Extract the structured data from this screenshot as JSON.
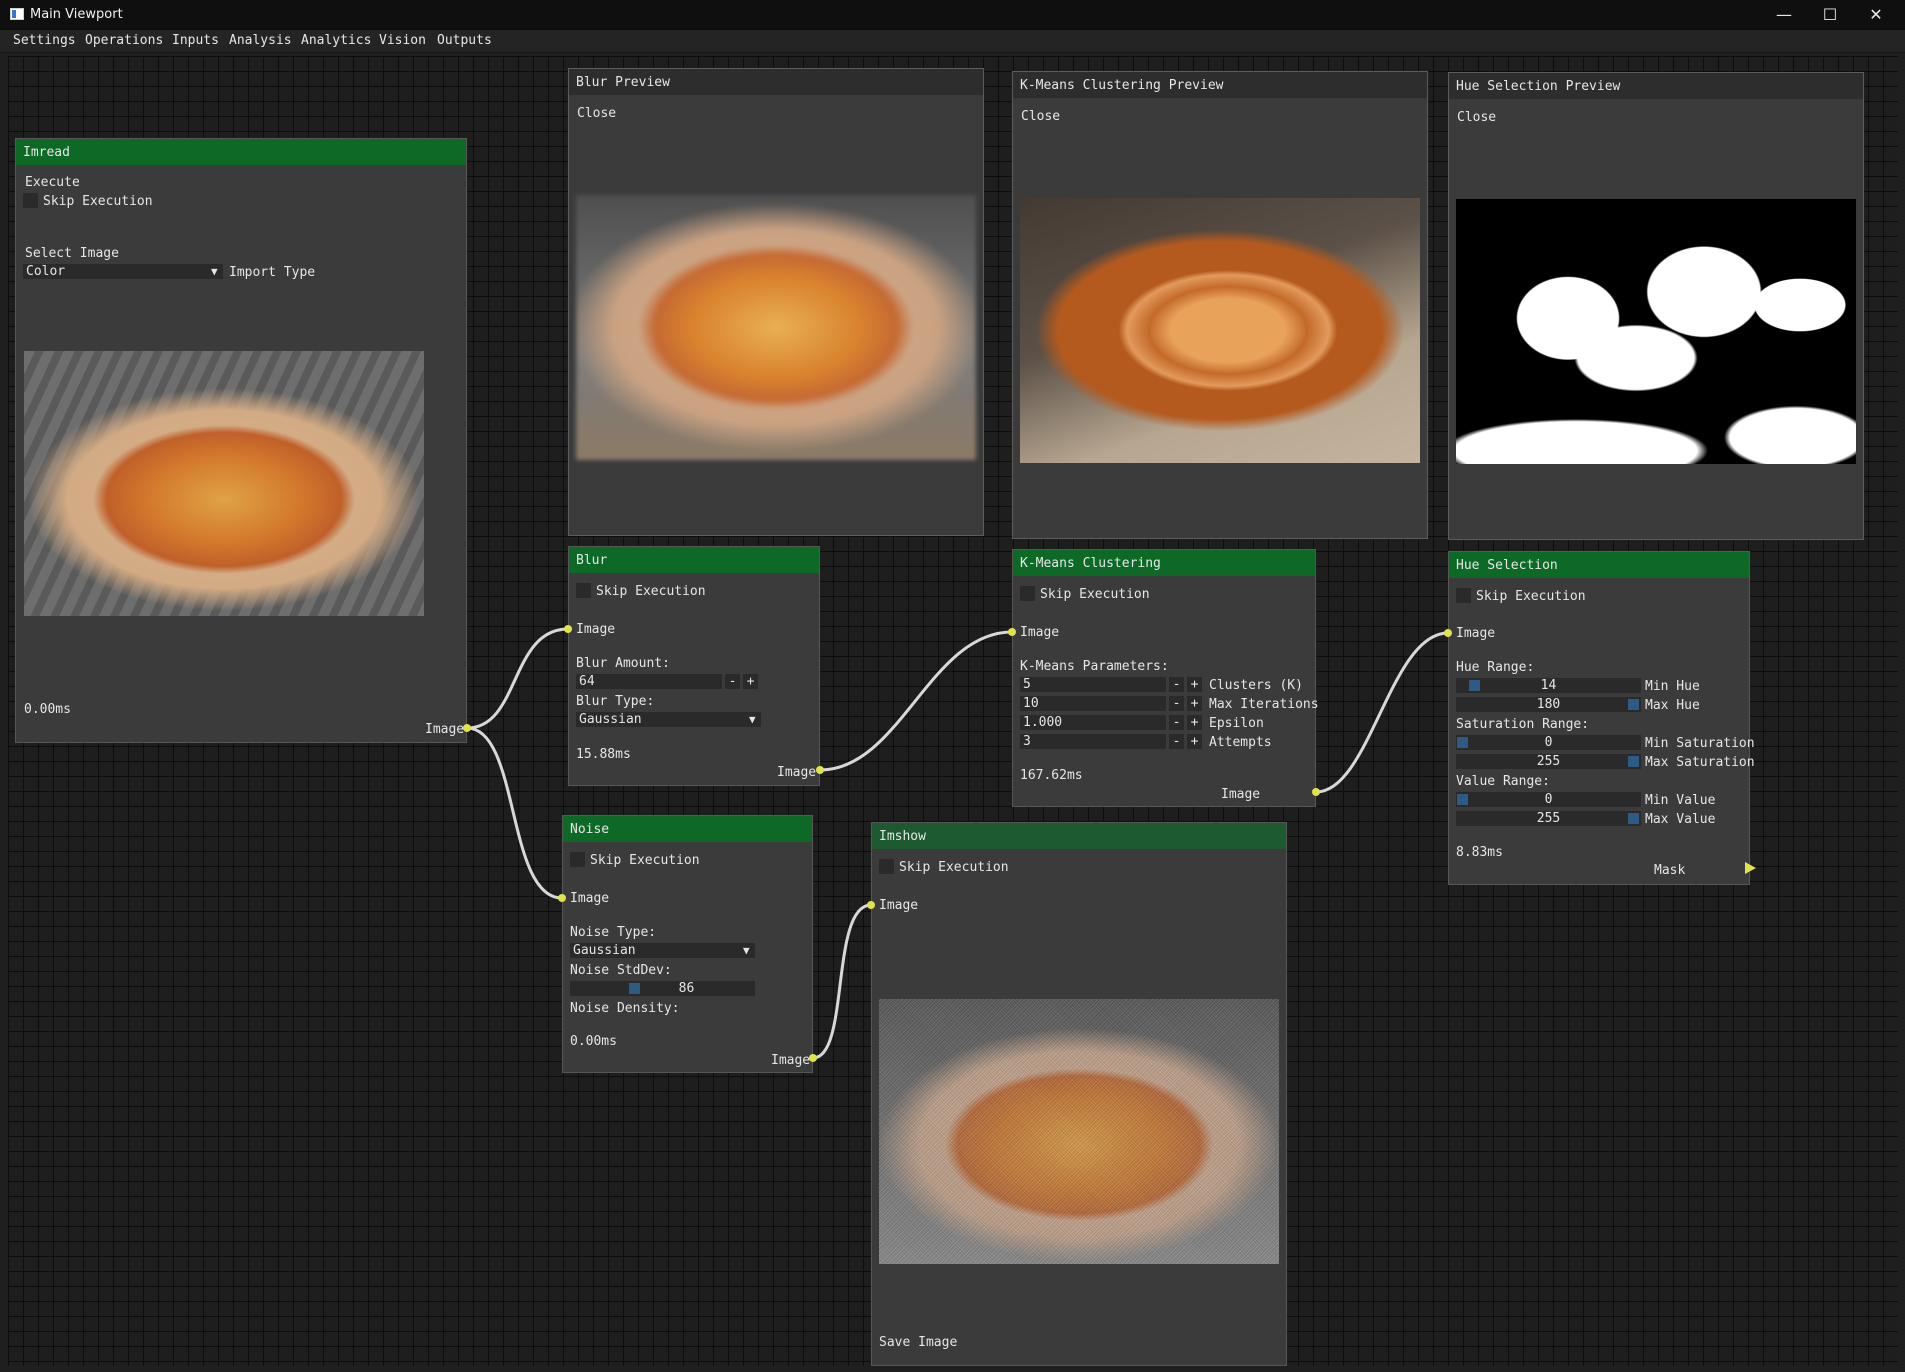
{
  "window": {
    "title": "Main Viewport",
    "minimize": "—",
    "maximize": "☐",
    "close": "✕"
  },
  "menu": [
    "Settings",
    "Operations",
    "Inputs",
    "Analysis",
    "Analytics",
    "Vision",
    "Outputs"
  ],
  "imread": {
    "title": "Imread",
    "execute": "Execute",
    "skip": "Skip Execution",
    "select_image": "Select Image",
    "import_value": "Color",
    "import_label": "Import Type",
    "time": "0.00ms",
    "out": "Image"
  },
  "blur_preview": {
    "title": "Blur Preview",
    "close": "Close"
  },
  "kmeans_preview": {
    "title": "K-Means Clustering Preview",
    "close": "Close"
  },
  "hue_preview": {
    "title": "Hue Selection Preview",
    "close": "Close"
  },
  "blur": {
    "title": "Blur",
    "skip": "Skip Execution",
    "in": "Image",
    "amount_label": "Blur Amount:",
    "amount": "64",
    "minus": "-",
    "plus": "+",
    "type_label": "Blur Type:",
    "type": "Gaussian",
    "time": "15.88ms",
    "out": "Image"
  },
  "kmeans": {
    "title": "K-Means Clustering",
    "skip": "Skip Execution",
    "in": "Image",
    "params_label": "K-Means Parameters:",
    "params": [
      {
        "value": "5",
        "label": "Clusters (K)"
      },
      {
        "value": "10",
        "label": "Max Iterations"
      },
      {
        "value": "1.000",
        "label": "Epsilon"
      },
      {
        "value": "3",
        "label": "Attempts"
      }
    ],
    "minus": "-",
    "plus": "+",
    "time": "167.62ms",
    "out": "Image"
  },
  "hue": {
    "title": "Hue Selection",
    "skip": "Skip Execution",
    "in": "Image",
    "hue_label": "Hue Range:",
    "min_hue": "14",
    "min_hue_label": "Min Hue",
    "max_hue": "180",
    "max_hue_label": "Max Hue",
    "sat_label": "Saturation Range:",
    "min_sat": "0",
    "min_sat_label": "Min Saturation",
    "max_sat": "255",
    "max_sat_label": "Max Saturation",
    "val_label": "Value Range:",
    "min_val": "0",
    "min_val_label": "Min Value",
    "max_val": "255",
    "max_val_label": "Max Value",
    "time": "8.83ms",
    "out": "Mask"
  },
  "noise": {
    "title": "Noise",
    "skip": "Skip Execution",
    "in": "Image",
    "type_label": "Noise Type:",
    "type": "Gaussian",
    "stddev_label": "Noise StdDev:",
    "stddev": "86",
    "density_label": "Noise Density:",
    "time": "0.00ms",
    "out": "Image"
  },
  "imshow": {
    "title": "Imshow",
    "skip": "Skip Execution",
    "in": "Image",
    "save": "Save Image"
  },
  "colors": {
    "node_header": "#0d6a26",
    "node_body": "#3b3b3b",
    "pin": "#e0e34b",
    "link": "#d8d8d8",
    "slider_thumb": "#2e5b86"
  }
}
